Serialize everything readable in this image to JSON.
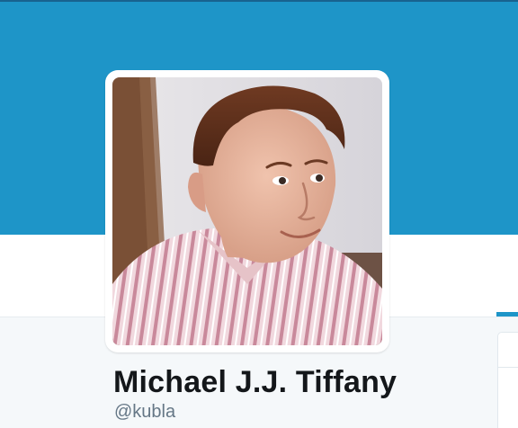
{
  "profile": {
    "name": "Michael J.J. Tiffany",
    "handle": "@kubla"
  },
  "colors": {
    "banner": "#1e95c8",
    "top_strip": "#18628f",
    "nav_background": "#ffffff",
    "page_background": "#f5f8fa",
    "name_text": "#14171a",
    "handle_text": "#657786",
    "active_tab_indicator": "#1e95c8"
  },
  "avatar": {
    "description_icon": "profile-photo",
    "subject": "man with short brown hair in a pink and white striped collared shirt"
  }
}
